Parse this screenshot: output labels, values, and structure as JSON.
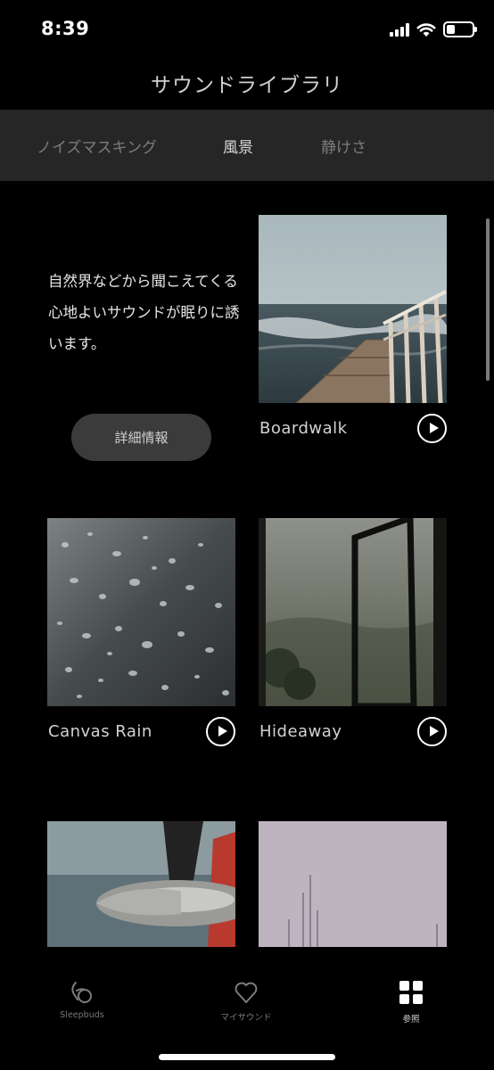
{
  "status_bar": {
    "time": "8:39"
  },
  "header": {
    "title": "サウンドライブラリ"
  },
  "tabs": [
    {
      "label": "ノイズマスキング",
      "active": false
    },
    {
      "label": "風景",
      "active": true
    },
    {
      "label": "静けさ",
      "active": false
    }
  ],
  "intro": {
    "text": "自然界などから聞こえてくる心地よいサウンドが眠りに誘います。",
    "details_label": "詳細情報"
  },
  "sounds": [
    {
      "title": "Boardwalk"
    },
    {
      "title": "Canvas Rain"
    },
    {
      "title": "Hideaway"
    }
  ],
  "bottom_nav": [
    {
      "label": "Sleepbuds",
      "icon": "sleepbuds-icon",
      "active": false
    },
    {
      "label": "マイサウンド",
      "icon": "heart-icon",
      "active": false
    },
    {
      "label": "参照",
      "icon": "grid-icon",
      "active": true
    }
  ],
  "colors": {
    "background": "#000000",
    "tab_bar": "#262626",
    "button": "#3b3b3b"
  }
}
